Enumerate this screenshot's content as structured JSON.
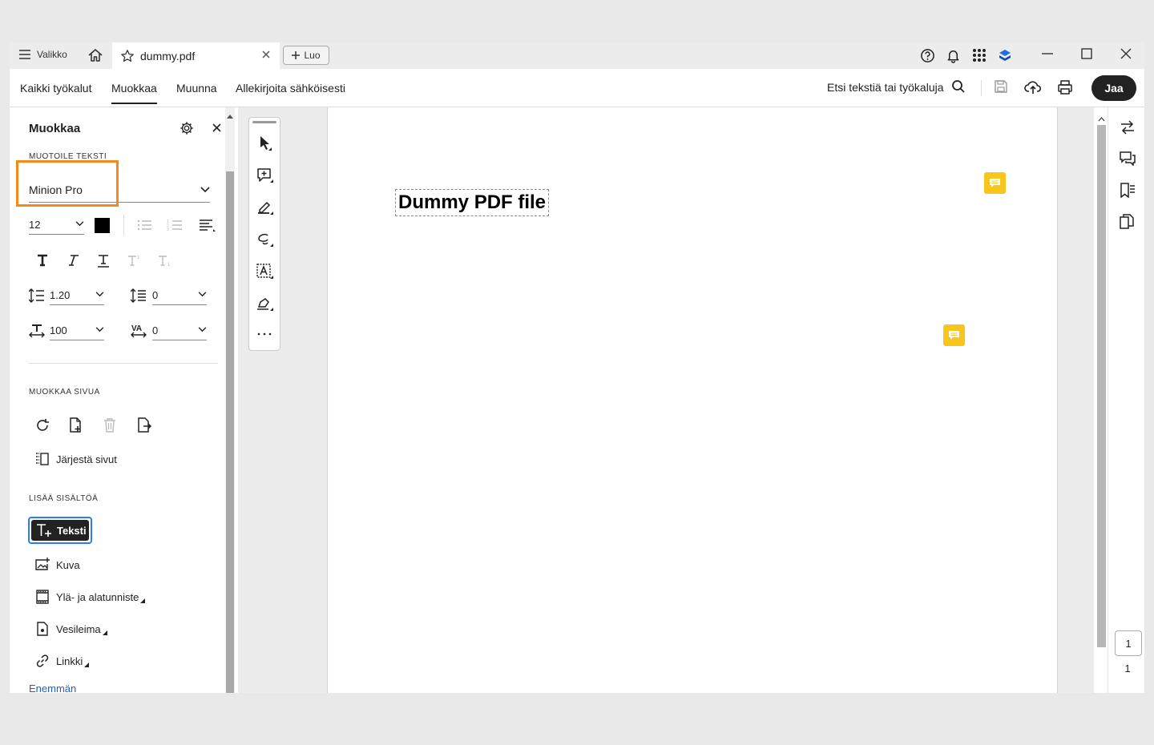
{
  "titlebar": {
    "menu_label": "Valikko",
    "tab_name": "dummy.pdf",
    "create_label": "Luo"
  },
  "toolbar": {
    "tabs": [
      {
        "label": "Kaikki työkalut"
      },
      {
        "label": "Muokkaa"
      },
      {
        "label": "Muunna"
      },
      {
        "label": "Allekirjoita sähköisesti"
      }
    ],
    "active_tab": "Muokkaa",
    "search_label": "Etsi tekstiä tai työkaluja",
    "share_label": "Jaa"
  },
  "panel": {
    "title": "Muokkaa",
    "format_heading": "MUOTOILE TEKSTI",
    "font_name": "Minion Pro",
    "font_size": "12",
    "line_spacing": "1.20",
    "paragraph_spacing": "0",
    "horizontal_scale": "100",
    "char_spacing": "0",
    "page_heading": "MUOKKAA SIVUA",
    "organize_label": "Järjestä sivut",
    "add_heading": "LISÄÄ SISÄLTÖÄ",
    "add_items": [
      {
        "label": "Teksti"
      },
      {
        "label": "Kuva"
      },
      {
        "label": "Ylä- ja alatunniste"
      },
      {
        "label": "Vesileima"
      },
      {
        "label": "Linkki"
      }
    ],
    "more_label": "Enemmän"
  },
  "document": {
    "title_text": "Dummy PDF file"
  },
  "pager": {
    "current": "1",
    "total": "1"
  },
  "colors": {
    "highlight": "#f28b1c",
    "note": "#f8c51c",
    "accent": "#2680eb",
    "text_color_swatch": "#000000"
  }
}
